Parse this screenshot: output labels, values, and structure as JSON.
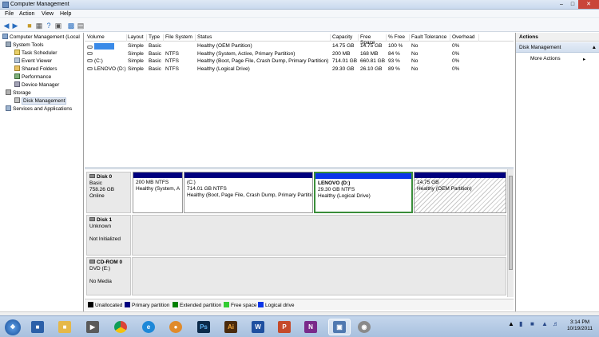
{
  "window": {
    "title": "Computer Management"
  },
  "menu": [
    "File",
    "Action",
    "View",
    "Help"
  ],
  "tree": [
    {
      "label": "Computer Management (Local",
      "level": 0,
      "icon": "computer-icon"
    },
    {
      "label": "System Tools",
      "level": 1,
      "icon": "tools-icon"
    },
    {
      "label": "Task Scheduler",
      "level": 2,
      "icon": "clock-icon"
    },
    {
      "label": "Event Viewer",
      "level": 2,
      "icon": "event-icon"
    },
    {
      "label": "Shared Folders",
      "level": 2,
      "icon": "folder-icon"
    },
    {
      "label": "Performance",
      "level": 2,
      "icon": "performance-icon"
    },
    {
      "label": "Device Manager",
      "level": 2,
      "icon": "device-icon"
    },
    {
      "label": "Storage",
      "level": 1,
      "icon": "storage-icon"
    },
    {
      "label": "Disk Management",
      "level": 2,
      "icon": "disk-icon"
    },
    {
      "label": "Services and Applications",
      "level": 1,
      "icon": "services-icon"
    }
  ],
  "volume_columns": [
    "Volume",
    "Layout",
    "Type",
    "File System",
    "Status",
    "Capacity",
    "Free Space",
    "% Free",
    "Fault Tolerance",
    "Overhead"
  ],
  "volumes": [
    {
      "volume": "",
      "layout": "Simple",
      "type": "Basic",
      "fs": "",
      "status": "Healthy (OEM Partition)",
      "capacity": "14.75 GB",
      "free": "14.75 GB",
      "pct": "100 %",
      "fault": "No",
      "overhead": "0%"
    },
    {
      "volume": "",
      "layout": "Simple",
      "type": "Basic",
      "fs": "NTFS",
      "status": "Healthy (System, Active, Primary Partition)",
      "capacity": "200 MB",
      "free": "168 MB",
      "pct": "84 %",
      "fault": "No",
      "overhead": "0%"
    },
    {
      "volume": "(C:)",
      "layout": "Simple",
      "type": "Basic",
      "fs": "NTFS",
      "status": "Healthy (Boot, Page File, Crash Dump, Primary Partition)",
      "capacity": "714.01 GB",
      "free": "660.81 GB",
      "pct": "93 %",
      "fault": "No",
      "overhead": "0%"
    },
    {
      "volume": "LENOVO (D:)",
      "layout": "Simple",
      "type": "Basic",
      "fs": "NTFS",
      "status": "Healthy (Logical Drive)",
      "capacity": "29.30 GB",
      "free": "26.10 GB",
      "pct": "89 %",
      "fault": "No",
      "overhead": "0%"
    }
  ],
  "disks": [
    {
      "name": "Disk 0",
      "type": "Basic",
      "size": "758.26 GB",
      "state": "Online",
      "partitions": [
        {
          "title": "",
          "size": "200 MB NTFS",
          "status": "Healthy (System, A"
        },
        {
          "title": "(C:)",
          "size": "714.01 GB NTFS",
          "status": "Healthy (Boot, Page File, Crash Dump, Primary Partitio"
        },
        {
          "title": "LENOVO  (D:)",
          "size": "29.30 GB NTFS",
          "status": "Healthy (Logical Drive)"
        },
        {
          "title": "",
          "size": "14.75 GB",
          "status": "Healthy (OEM Partition)"
        }
      ]
    },
    {
      "name": "Disk 1",
      "type": "Unknown",
      "state": "Not Initialized"
    },
    {
      "name": "CD-ROM 0",
      "type": "DVD (E:)",
      "state": "No Media"
    }
  ],
  "legend": [
    {
      "label": "Unallocated",
      "color": "#000000"
    },
    {
      "label": "Primary partition",
      "color": "#00007f"
    },
    {
      "label": "Extended partition",
      "color": "#008000"
    },
    {
      "label": "Free space",
      "color": "#33cc33"
    },
    {
      "label": "Logical drive",
      "color": "#0b35e8"
    }
  ],
  "actions": {
    "header": "Actions",
    "section": "Disk Management",
    "more": "More Actions"
  },
  "taskbar": {
    "time": "3:14 PM",
    "date": "10/19/2011"
  }
}
